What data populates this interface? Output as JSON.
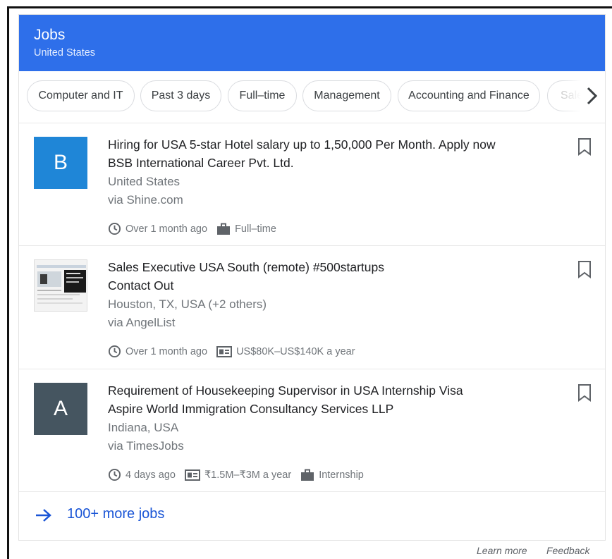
{
  "header": {
    "title": "Jobs",
    "subtitle": "United States"
  },
  "chips": [
    {
      "label": "Computer and IT"
    },
    {
      "label": "Past 3 days"
    },
    {
      "label": "Full–time"
    },
    {
      "label": "Management"
    },
    {
      "label": "Accounting and Finance"
    },
    {
      "label": "Sales and"
    }
  ],
  "jobs": [
    {
      "logo_letter": "B",
      "logo_color": "#1f86d7",
      "title": "Hiring for USA 5-star Hotel salary up to 1,50,000 Per Month. Apply now",
      "company": "BSB International Career Pvt. Ltd.",
      "location": "United States",
      "source": "via Shine.com",
      "posted": "Over 1 month ago",
      "type": "Full–time"
    },
    {
      "logo_letter": "",
      "logo_color": "#f4f4f4",
      "title": "Sales Executive USA South (remote) #500startups",
      "company": "Contact Out",
      "location": "Houston, TX, USA (+2 others)",
      "source": "via AngelList",
      "posted": "Over 1 month ago",
      "salary": "US$80K–US$140K a year"
    },
    {
      "logo_letter": "A",
      "logo_color": "#455560",
      "title": "Requirement of Housekeeping Supervisor in USA Internship Visa",
      "company": "Aspire World Immigration Consultancy Services LLP",
      "location": "Indiana, USA",
      "source": "via TimesJobs",
      "posted": "4 days ago",
      "salary": "₹1.5M–₹3M a year",
      "type": "Internship"
    }
  ],
  "more": {
    "label": "100+ more jobs"
  },
  "footer": {
    "learn_more": "Learn more",
    "feedback": "Feedback"
  },
  "icons": {
    "chevron": "chevron-right-icon",
    "bookmark": "bookmark-icon",
    "clock": "clock-icon",
    "briefcase": "briefcase-icon",
    "salary": "salary-icon",
    "arrow": "arrow-right-icon"
  },
  "colors": {
    "header": "#2e6fea",
    "link": "#1a55d6"
  }
}
